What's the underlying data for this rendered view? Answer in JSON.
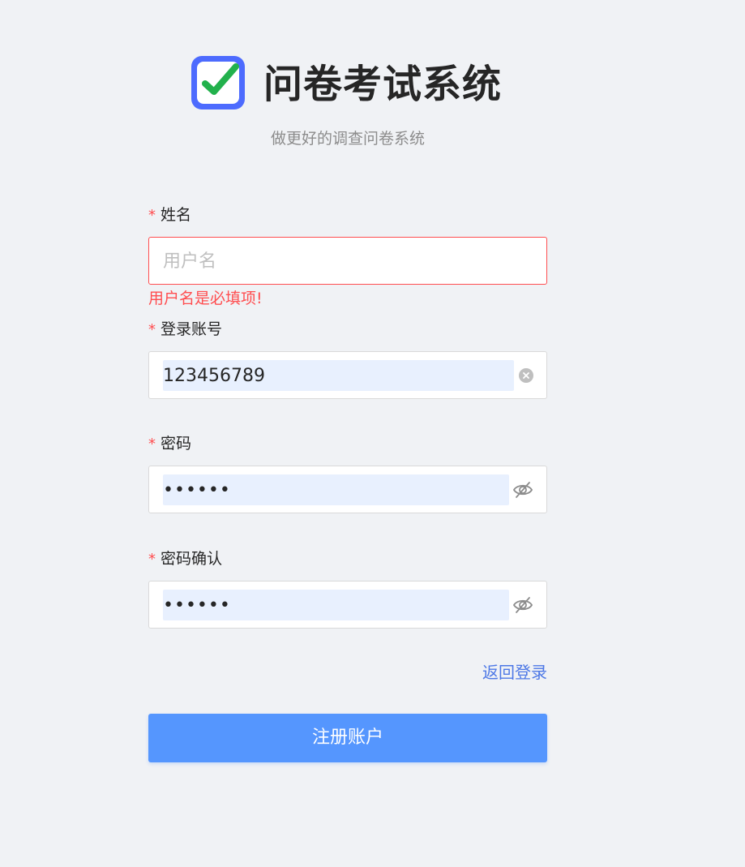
{
  "header": {
    "title": "问卷考试系统",
    "subtitle": "做更好的调查问卷系统",
    "logo_icon": "checkbox-logo-icon"
  },
  "form": {
    "name": {
      "label": "姓名",
      "required_mark": "*",
      "placeholder": "用户名",
      "value": "",
      "error": "用户名是必填项!"
    },
    "account": {
      "label": "登录账号",
      "required_mark": "*",
      "value": "123456789",
      "clear_icon": "clear-icon"
    },
    "password": {
      "label": "密码",
      "required_mark": "*",
      "value": "••••••",
      "toggle_icon": "eye-hidden-icon"
    },
    "password_confirm": {
      "label": "密码确认",
      "required_mark": "*",
      "value": "••••••",
      "toggle_icon": "eye-hidden-icon"
    },
    "back_login_label": "返回登录",
    "submit_label": "注册账户"
  },
  "colors": {
    "primary": "#5596fe",
    "link": "#4d78e6",
    "error": "#ff4d4f",
    "logo": "#4d6bfe",
    "check": "#22b14c",
    "background": "#f0f2f5"
  }
}
